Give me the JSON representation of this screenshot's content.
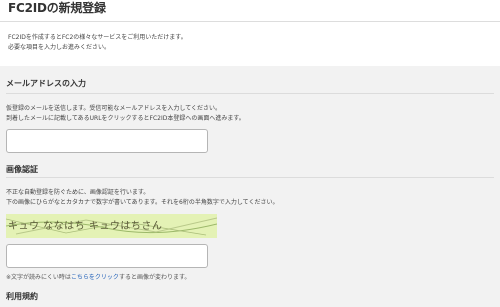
{
  "page_title": "FC2IDの新規登録",
  "intro": {
    "line1": "FC2IDを作成するとFC2の様々なサービスをご利用いただけます。",
    "line2": "必要な項目を入力しお進みください。"
  },
  "email_section": {
    "heading": "メールアドレスの入力",
    "line1": "仮登録のメールを送信します。受信可能なメールアドレスを入力してください。",
    "line2": "到着したメールに記載してあるURLをクリックするとFC2ID本登録への画面へ進みます。",
    "input_value": ""
  },
  "captcha_section": {
    "heading": "画像認証",
    "line1": "不正な自動登録を防ぐために、画像認証を行います。",
    "line2": "下の画像にひらがなとカタカナで数字が書いてあります。それを6桁の半角数字で入力してください。",
    "image_text": "キュウ ななはち キュウはちさん",
    "input_value": "",
    "note_prefix": "※文字が読みにくい時は",
    "note_link": "こちらをクリック",
    "note_suffix": "すると画像が変わります。"
  },
  "terms_section": {
    "heading": "利用規約"
  },
  "colors": {
    "panel_bg": "#f2f2f2",
    "link": "#1f5fb8",
    "captcha_bg": "#e4f2b5"
  }
}
